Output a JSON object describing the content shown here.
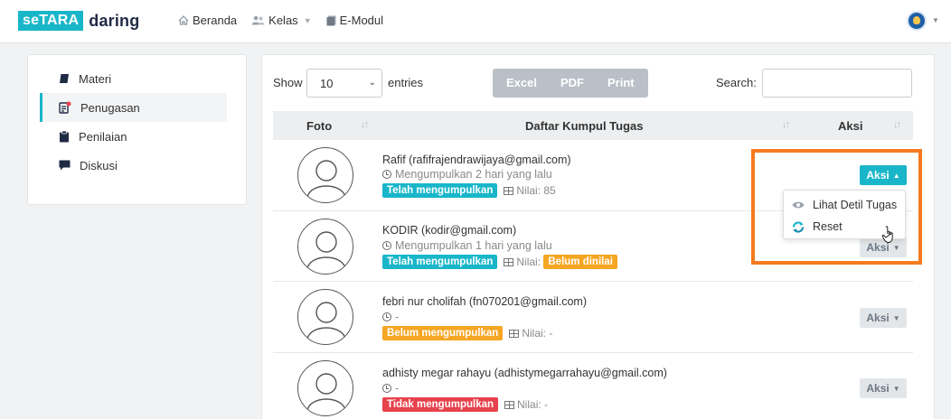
{
  "brand": {
    "part1": "seTARA",
    "part2": "daring",
    "accent": "#19b6c9"
  },
  "nav": {
    "home": "Beranda",
    "class": "Kelas",
    "module": "E-Modul"
  },
  "sidebar": {
    "items": [
      {
        "label": "Materi",
        "icon": "book-icon"
      },
      {
        "label": "Penugasan",
        "icon": "assignment-icon"
      },
      {
        "label": "Penilaian",
        "icon": "clipboard-icon"
      },
      {
        "label": "Diskusi",
        "icon": "chat-icon"
      }
    ]
  },
  "controls": {
    "show": "Show",
    "length_value": "10",
    "entries": "entries",
    "buttons": [
      "Excel",
      "PDF",
      "Print"
    ],
    "search_label": "Search:",
    "search_value": ""
  },
  "table": {
    "headers": [
      "Foto",
      "Daftar Kumpul Tugas",
      "Aksi"
    ],
    "rows": [
      {
        "name": "Rafif (rafifrajendrawijaya@gmail.com)",
        "time": "Mengumpulkan 2 hari yang lalu",
        "status": "Telah mengumpulkan",
        "status_color": "#19b6c9",
        "nilai_label": "Nilai:",
        "nilai": "85",
        "aksi": "Aksi"
      },
      {
        "name": "KODIR (kodir@gmail.com)",
        "time": "Mengumpulkan 1 hari yang lalu",
        "status": "Telah mengumpulkan",
        "status_color": "#19b6c9",
        "nilai_label": "Nilai:",
        "nilai": "Belum dinilai",
        "aksi": "Aksi"
      },
      {
        "name": "febri nur cholifah (fn070201@gmail.com)",
        "time": "-",
        "status": "Belum mengumpulkan",
        "status_color": "#f5a623",
        "nilai_label": "Nilai:",
        "nilai": "-",
        "aksi": "Aksi"
      },
      {
        "name": "adhisty megar rahayu (adhistymegarrahayu@gmail.com)",
        "time": "-",
        "status": "Tidak mengumpulkan",
        "status_color": "#e8424d",
        "nilai_label": "Nilai:",
        "nilai": "-",
        "aksi": "Aksi"
      }
    ]
  },
  "dropdown": {
    "items": [
      "Lihat Detil Tugas",
      "Reset"
    ]
  },
  "highlight_color": "#f47b20"
}
